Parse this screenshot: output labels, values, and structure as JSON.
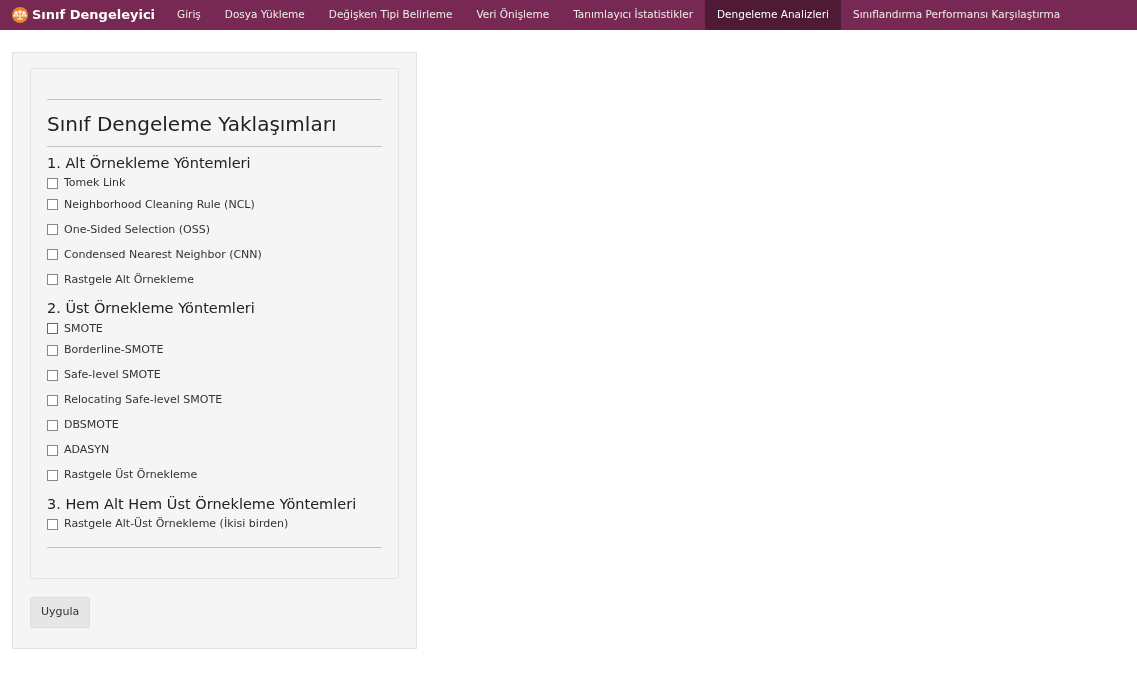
{
  "navbar": {
    "brand": "Sınıf Dengeleyici",
    "items": [
      {
        "label": "Giriş",
        "selected": false
      },
      {
        "label": "Dosya Yükleme",
        "selected": false
      },
      {
        "label": "Değişken Tipi Belirleme",
        "selected": false
      },
      {
        "label": "Veri Önişleme",
        "selected": false
      },
      {
        "label": "Tanımlayıcı İstatistikler",
        "selected": false
      },
      {
        "label": "Dengeleme Analizleri",
        "selected": true
      },
      {
        "label": "Sınıflandırma Performansı Karşılaştırma",
        "selected": false
      }
    ]
  },
  "panel": {
    "title": "Sınıf Dengeleme Yaklaşımları",
    "groups": [
      {
        "heading": "1. Alt Örnekleme Yöntemleri",
        "options": [
          {
            "label": "Tomek Link",
            "checked": false,
            "focused": false
          },
          {
            "label": "Neighborhood Cleaning Rule (NCL)",
            "checked": false,
            "focused": false
          },
          {
            "label": "One-Sided Selection (OSS)",
            "checked": false,
            "focused": false
          },
          {
            "label": "Condensed Nearest Neighbor (CNN)",
            "checked": false,
            "focused": false
          },
          {
            "label": "Rastgele Alt Örnekleme",
            "checked": false,
            "focused": false
          }
        ]
      },
      {
        "heading": "2. Üst Örnekleme Yöntemleri",
        "options": [
          {
            "label": "SMOTE",
            "checked": false,
            "focused": true
          },
          {
            "label": "Borderline-SMOTE",
            "checked": false,
            "focused": false
          },
          {
            "label": "Safe-level SMOTE",
            "checked": false,
            "focused": false
          },
          {
            "label": "Relocating Safe-level SMOTE",
            "checked": false,
            "focused": false
          },
          {
            "label": "DBSMOTE",
            "checked": false,
            "focused": false
          },
          {
            "label": "ADASYN",
            "checked": false,
            "focused": false
          },
          {
            "label": "Rastgele Üst Örnekleme",
            "checked": false,
            "focused": false
          }
        ]
      },
      {
        "heading": "3. Hem Alt Hem Üst Örnekleme Yöntemleri",
        "options": [
          {
            "label": "Rastgele Alt-Üst Örnekleme (İkisi birden)",
            "checked": false,
            "focused": false
          }
        ]
      }
    ],
    "button": "Uygula"
  }
}
